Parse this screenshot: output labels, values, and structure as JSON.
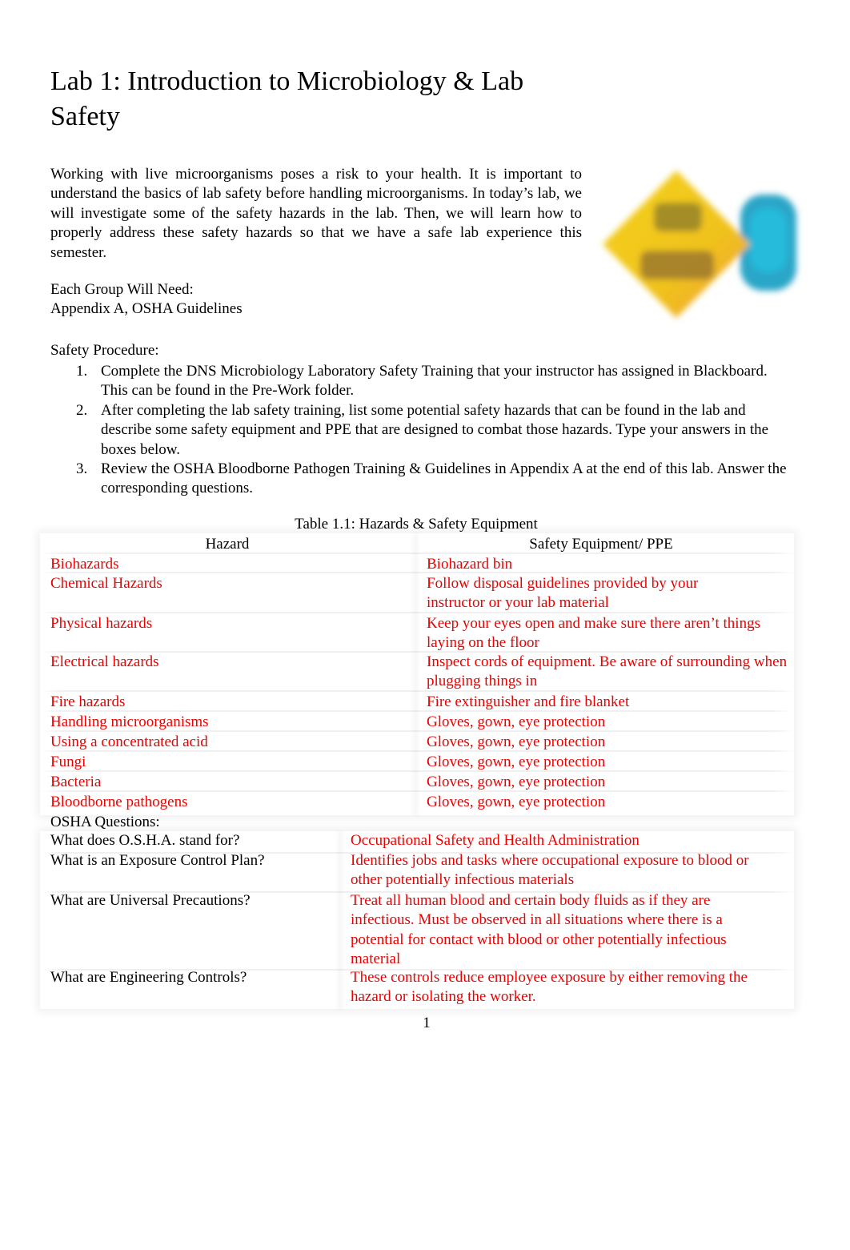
{
  "document": {
    "title": "Lab 1: Introduction to Microbiology & Lab Safety",
    "intro": "Working with live microorganisms poses a risk to your health. It is important to understand the basics of lab safety before handling microorganisms. In today’s lab, we will investigate some of the safety hazards in the lab. Then, we will learn how to properly address these safety hazards so that we have a safe lab experience this semester.",
    "needs_heading": "Each Group Will Need:",
    "needs_value": "Appendix A, OSHA Guidelines",
    "logo_icon": "lab-safety-sign-image",
    "procedure_heading": "Safety Procedure:",
    "procedure": [
      {
        "num": "1.",
        "text": "Complete the DNS Microbiology Laboratory Safety Training that your instructor has assigned in Blackboard. This can be found in the Pre-Work folder."
      },
      {
        "num": "2.",
        "text": "After completing the lab safety training, list some potential safety hazards that can be found in the lab and describe some safety equipment and PPE that are designed to combat those hazards. Type your answers in the boxes below."
      },
      {
        "num": "3.",
        "text": "Review the OSHA Bloodborne Pathogen Training & Guidelines in Appendix A at the end of this lab. Answer the corresponding questions."
      }
    ],
    "table_caption": "Table 1.1: Hazards & Safety Equipment",
    "table_headers": [
      "Hazard",
      "Safety Equipment/ PPE"
    ],
    "table_rows": [
      {
        "hazard": "Biohazards",
        "equipment": "Biohazard bin"
      },
      {
        "hazard": "Chemical Hazards",
        "equipment": "Follow disposal guidelines provided by your instructor or your lab material"
      },
      {
        "hazard": "Physical hazards",
        "equipment": "Keep your eyes open and make sure there aren’t things laying on the floor"
      },
      {
        "hazard": "Electrical hazards",
        "equipment": "Inspect cords of equipment. Be aware of surrounding when plugging things in"
      },
      {
        "hazard": "Fire hazards",
        "equipment": "Fire extinguisher and fire blanket"
      },
      {
        "hazard": "Handling microorganisms",
        "equipment": "Gloves, gown, eye protection"
      },
      {
        "hazard": "Using a concentrated acid",
        "equipment": "Gloves, gown, eye protection"
      },
      {
        "hazard": "Fungi",
        "equipment": "Gloves, gown, eye protection"
      },
      {
        "hazard": "Bacteria",
        "equipment": "Gloves, gown, eye protection"
      },
      {
        "hazard": "Bloodborne pathogens",
        "equipment": "Gloves, gown, eye protection"
      }
    ],
    "osha_heading": "OSHA Questions:",
    "osha_questions": [
      {
        "q": "What does O.S.H.A. stand for?",
        "a": "Occupational Safety and Health Administration"
      },
      {
        "q": "What is an Exposure Control Plan?",
        "a": "Identifies jobs and tasks where occupational exposure to blood or other potentially infectious materials"
      },
      {
        "q": "What are Universal Precautions?",
        "a": "Treat all human blood and certain body fluids as if they are infectious. Must be observed in all situations where there is a potential for contact with blood or other potentially infectious material"
      },
      {
        "q": "What are Engineering Controls?",
        "a": "These controls reduce employee exposure by either removing the hazard or isolating the worker."
      }
    ],
    "page_number": "1",
    "answer_color": "#ee0000"
  }
}
